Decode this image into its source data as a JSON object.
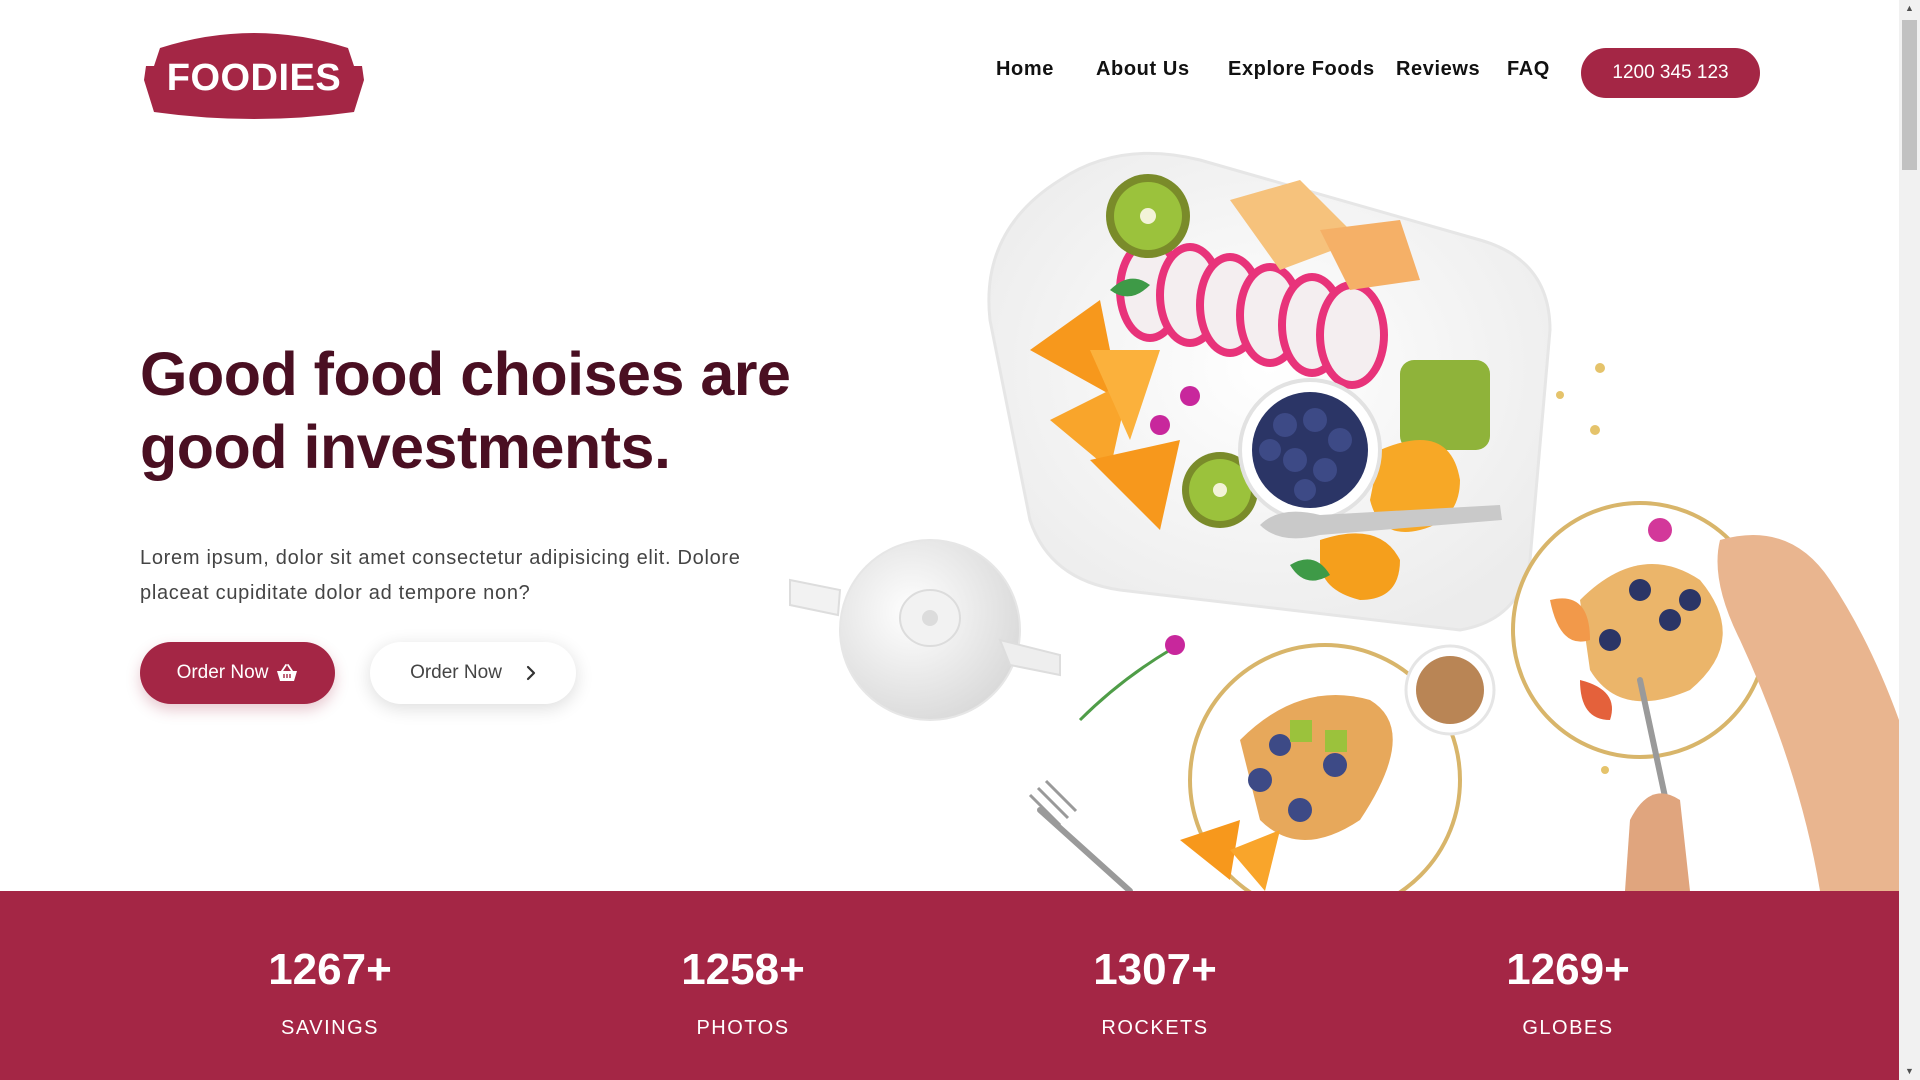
{
  "brand": {
    "logo_text": "FOODIES",
    "color": "#a42645",
    "dark_color": "#4a0f22"
  },
  "nav": {
    "items": [
      "Home",
      "About Us",
      "Explore Foods",
      "Reviews",
      "FAQ"
    ],
    "phone": "1200 345 123"
  },
  "hero": {
    "headline_line1": "Good food choises are",
    "headline_line2": "good investments.",
    "intro_line1": "Lorem ipsum, dolor sit amet consectetur adipisicing elit. Dolore",
    "intro_line2": "placeat cupiditate dolor ad tempore non?",
    "primary_button": "Order Now",
    "secondary_button": "Order Now",
    "icons": {
      "primary": "basket-icon",
      "secondary": "chevron-right-icon"
    }
  },
  "stats": [
    {
      "value": "1267+",
      "label": "SAVINGS"
    },
    {
      "value": "1258+",
      "label": "PHOTOS"
    },
    {
      "value": "1307+",
      "label": "ROCKETS"
    },
    {
      "value": "1269+",
      "label": "GLOBES"
    }
  ]
}
